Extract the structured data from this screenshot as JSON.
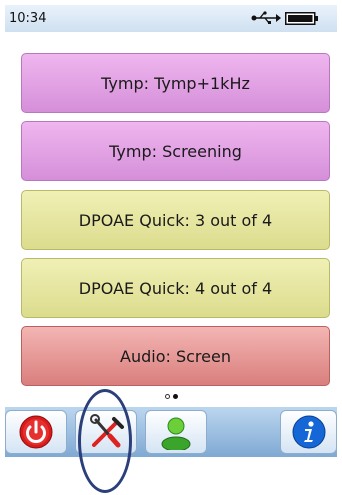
{
  "status": {
    "time": "10:34",
    "usb_icon": "usb-icon",
    "battery_icon": "battery-icon"
  },
  "tests": [
    {
      "label": "Tymp: Tymp+1kHz",
      "color": "#e2a2e4"
    },
    {
      "label": "Tymp: Screening",
      "color": "#e2a2e4"
    },
    {
      "label": "DPOAE Quick: 3 out of 4",
      "color": "#e6e6a0"
    },
    {
      "label": "DPOAE Quick: 4 out of 4",
      "color": "#e6e6a0"
    },
    {
      "label": "Audio: Screen",
      "color": "#e59896"
    }
  ],
  "pager": {
    "pages": 2,
    "current": 2
  },
  "toolbar": {
    "buttons": [
      {
        "icon": "power-icon"
      },
      {
        "icon": "tools-icon"
      },
      {
        "icon": "user-icon"
      },
      {
        "icon": "info-icon"
      }
    ]
  },
  "accent_colors": {
    "status_bar": "#d8e7f6",
    "toolbar": "#9bbde1",
    "annotation_circle": "#2b3f7a"
  }
}
